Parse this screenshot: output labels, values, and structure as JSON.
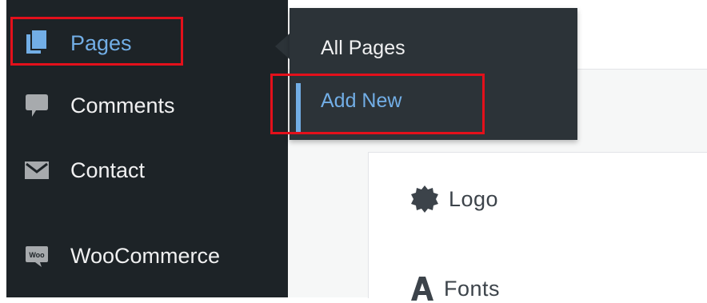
{
  "sidebar": {
    "items": [
      {
        "label": "Pages",
        "icon": "pages-icon",
        "active": true
      },
      {
        "label": "Comments",
        "icon": "comment-icon"
      },
      {
        "label": "Contact",
        "icon": "envelope-icon"
      },
      {
        "label": "WooCommerce",
        "icon": "woocommerce-icon",
        "icon_text": "Woo"
      }
    ]
  },
  "flyout": {
    "items": [
      {
        "label": "All Pages"
      },
      {
        "label": "Add New",
        "current": true
      }
    ]
  },
  "panel": {
    "items": [
      {
        "label": "Logo",
        "icon": "badge-icon"
      },
      {
        "label": "Fonts",
        "icon": "font-icon"
      }
    ]
  },
  "colors": {
    "sidebar_bg": "#1d2327",
    "flyout_bg": "#2c3338",
    "accent": "#72aee6",
    "highlight_red": "#e3101b",
    "menu_text": "#f0f0f1"
  }
}
